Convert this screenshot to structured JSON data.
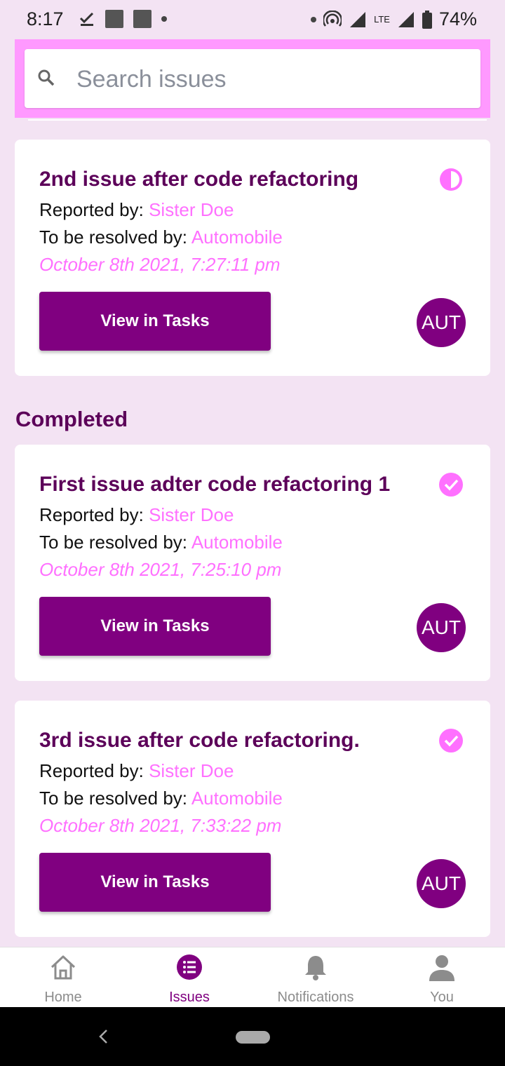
{
  "status_bar": {
    "time": "8:17",
    "network": "LTE",
    "battery": "74%"
  },
  "search": {
    "placeholder": "Search issues",
    "value": ""
  },
  "colors": {
    "primary": "#800080",
    "accent": "#ff70ff",
    "title": "#5c0059",
    "background": "#f3e3f3",
    "search_bar": "#ff99ff"
  },
  "issues": [
    {
      "title": "2nd issue after code refactoring",
      "reported_label": "Reported by: ",
      "reporter": "Sister Doe",
      "resolver_label": "To be resolved by: ",
      "resolver": "Automobile",
      "date": "October 8th 2021, 7:27:11 pm",
      "button": "View in Tasks",
      "avatar": "AUT",
      "status_icon": "half-circle-icon"
    }
  ],
  "completed_section": {
    "header": "Completed",
    "issues": [
      {
        "title": "First issue adter code refactoring 1",
        "reported_label": "Reported by: ",
        "reporter": "Sister Doe",
        "resolver_label": "To be resolved by: ",
        "resolver": "Automobile",
        "date": "October 8th 2021, 7:25:10 pm",
        "button": "View in Tasks",
        "avatar": "AUT",
        "status_icon": "check-circle-icon"
      },
      {
        "title": "3rd issue after code refactoring.",
        "reported_label": "Reported by: ",
        "reporter": "Sister Doe",
        "resolver_label": "To be resolved by: ",
        "resolver": "Automobile",
        "date": "October 8th 2021, 7:33:22 pm",
        "button": "View in Tasks",
        "avatar": "AUT",
        "status_icon": "check-circle-icon"
      }
    ]
  },
  "bottom_nav": {
    "items": [
      {
        "label": "Home",
        "icon": "home-icon"
      },
      {
        "label": "Issues",
        "icon": "list-icon"
      },
      {
        "label": "Notifications",
        "icon": "bell-icon"
      },
      {
        "label": "You",
        "icon": "person-icon"
      }
    ],
    "active": "Issues"
  }
}
